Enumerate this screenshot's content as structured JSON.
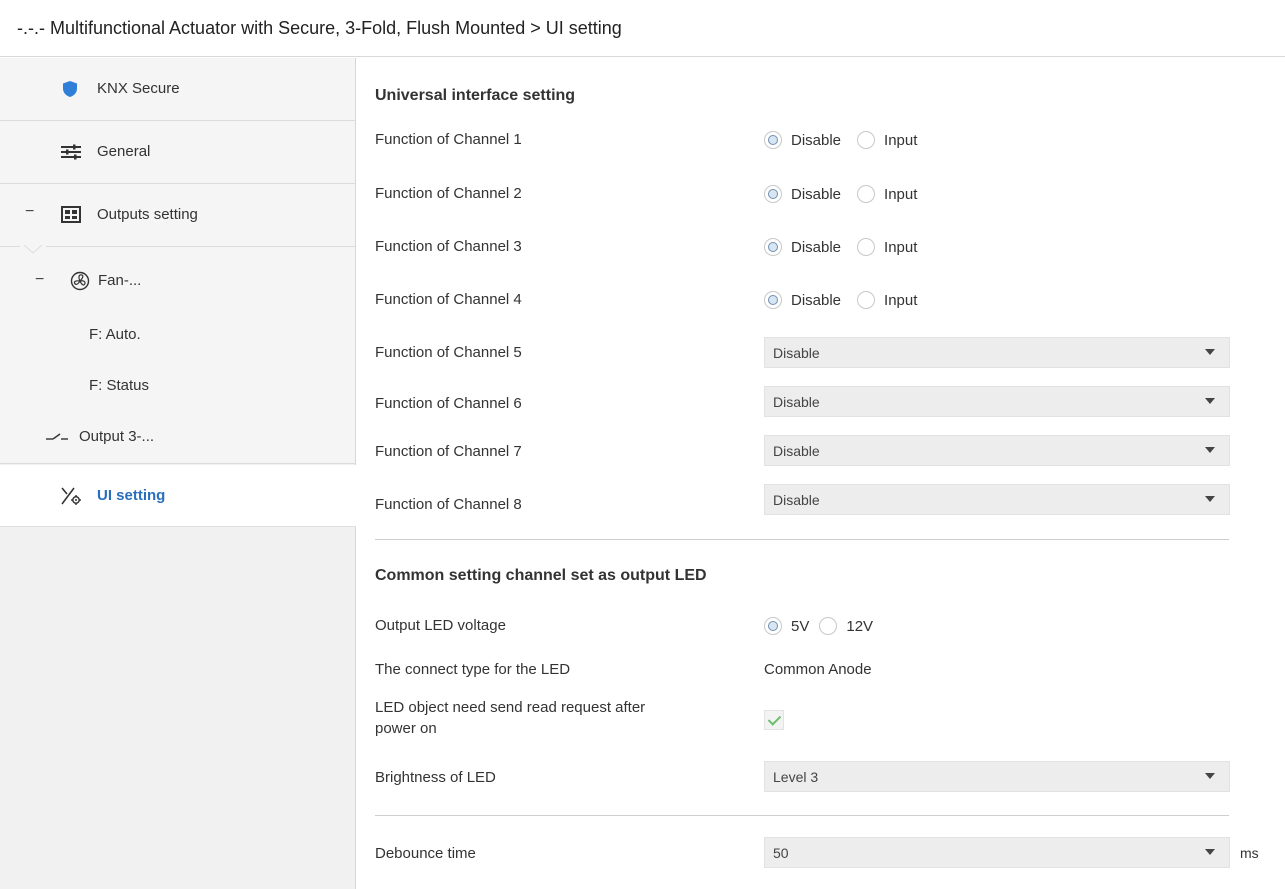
{
  "header": {
    "title": "-.-.- Multifunctional Actuator with Secure, 3-Fold, Flush Mounted > UI setting"
  },
  "sidebar": {
    "items": [
      {
        "label": "KNX Secure",
        "icon": "shield-icon"
      },
      {
        "label": "General",
        "icon": "sliders-icon"
      },
      {
        "label": "Outputs setting",
        "icon": "grid-icon",
        "collapse": "−"
      },
      {
        "label": "Fan-...",
        "icon": "fan-icon",
        "collapse": "−"
      },
      {
        "label": "F: Auto."
      },
      {
        "label": "F: Status"
      },
      {
        "label": "Output 3-...",
        "icon": "switch-icon"
      },
      {
        "label": "UI setting",
        "icon": "ui-setting-icon",
        "active": true
      }
    ],
    "active_color": "#2a6ebb"
  },
  "main": {
    "section1_title": "Universal interface setting",
    "channels_radio": [
      {
        "label": "Function of Channel 1",
        "options": [
          "Disable",
          "Input"
        ],
        "selected": "Disable"
      },
      {
        "label": "Function of Channel 2",
        "options": [
          "Disable",
          "Input"
        ],
        "selected": "Disable"
      },
      {
        "label": "Function of Channel 3",
        "options": [
          "Disable",
          "Input"
        ],
        "selected": "Disable"
      },
      {
        "label": "Function of Channel 4",
        "options": [
          "Disable",
          "Input"
        ],
        "selected": "Disable"
      }
    ],
    "channels_select": [
      {
        "label": "Function of Channel 5",
        "value": "Disable"
      },
      {
        "label": "Function of Channel 6",
        "value": "Disable"
      },
      {
        "label": "Function of Channel 7",
        "value": "Disable"
      },
      {
        "label": "Function of Channel 8",
        "value": "Disable"
      }
    ],
    "section2_title": "Common setting channel set as output LED",
    "led_voltage": {
      "label": "Output LED voltage",
      "options": [
        "5V",
        "12V"
      ],
      "selected": "5V"
    },
    "connect_type": {
      "label": "The connect type for the LED",
      "value": "Common Anode"
    },
    "read_request": {
      "label_line1": "LED object need send read request after",
      "label_line2": "power on",
      "checked": true
    },
    "brightness": {
      "label": "Brightness of LED",
      "value": "Level 3"
    },
    "debounce": {
      "label": "Debounce time",
      "value": "50",
      "unit": "ms"
    }
  }
}
